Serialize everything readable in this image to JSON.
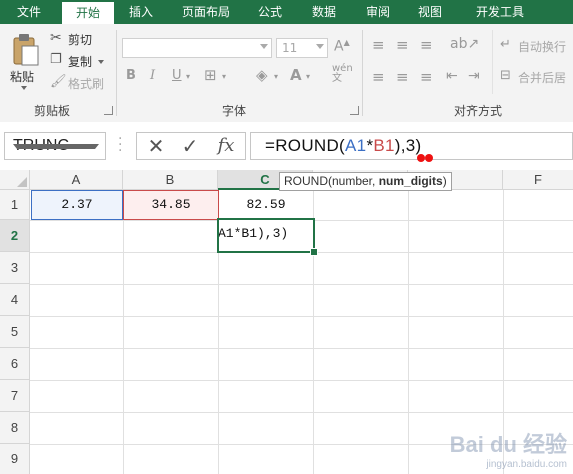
{
  "ribbon_tabs": [
    "文件",
    "开始",
    "插入",
    "页面布局",
    "公式",
    "数据",
    "审阅",
    "视图",
    "开发工具"
  ],
  "active_tab": "开始",
  "clipboard": {
    "paste": "粘贴",
    "cut": "剪切",
    "copy": "复制",
    "format_painter": "格式刷",
    "group_label": "剪贴板"
  },
  "font": {
    "name": "",
    "size": "11",
    "bold": "B",
    "italic": "I",
    "underline": "U",
    "group_label": "字体"
  },
  "alignment": {
    "wrap_text": "自动换行",
    "merge_center": "合并后居",
    "group_label": "对齐方式"
  },
  "formula_bar": {
    "name_box": "TRUNC",
    "cancel": "✕",
    "enter": "✓",
    "fx": "fx",
    "formula_prefix": "=ROUND(",
    "formula_ref_a": "A1",
    "formula_op": "*",
    "formula_ref_b": "B1",
    "formula_suffix": "),3)"
  },
  "tooltip": {
    "func": "ROUND(number, ",
    "arg": "num_digits",
    "close": ")"
  },
  "columns": [
    "A",
    "B",
    "C",
    "",
    "",
    "F"
  ],
  "rows": [
    "1",
    "2",
    "3",
    "4",
    "5",
    "6",
    "7",
    "8",
    "9"
  ],
  "cells": {
    "A1": "2.37",
    "B1": "34.85",
    "C1": "82.59",
    "C2": "A1*B1),3)"
  },
  "watermark": {
    "brand": "Bai du 经验",
    "url": "jingyan.baidu.com"
  },
  "colors": {
    "excel_green": "#217346",
    "ref_a": "#3c6fc4",
    "ref_b": "#c94a4a"
  }
}
